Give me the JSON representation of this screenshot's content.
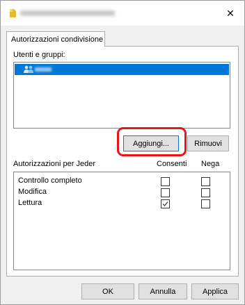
{
  "window": {
    "close_glyph": "✕"
  },
  "tab": {
    "label": "Autorizzazioni condivisione"
  },
  "users": {
    "label": "Utenti e gruppi:"
  },
  "buttons": {
    "add": "Aggiungi...",
    "remove": "Rimuovi",
    "ok": "OK",
    "cancel": "Annulla",
    "apply": "Applica"
  },
  "permissions": {
    "label": "Autorizzazioni per Jeder",
    "col_allow": "Consenti",
    "col_deny": "Nega",
    "rows": [
      {
        "name": "Controllo completo",
        "allow": false,
        "deny": false
      },
      {
        "name": "Modifica",
        "allow": false,
        "deny": false
      },
      {
        "name": "Lettura",
        "allow": true,
        "deny": false
      }
    ]
  },
  "colors": {
    "selection": "#0078d7",
    "highlight": "#e8151b",
    "folder": "#e8b830"
  }
}
